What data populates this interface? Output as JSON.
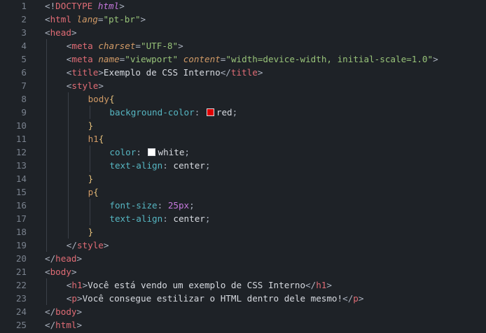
{
  "editor": {
    "lines": [
      {
        "n": "1",
        "indent": 0,
        "tokens": [
          {
            "t": "<!",
            "c": "punc"
          },
          {
            "t": "DOCTYPE",
            "c": "tag"
          },
          {
            "t": " ",
            "c": "text"
          },
          {
            "t": "html",
            "c": "kw"
          },
          {
            "t": ">",
            "c": "punc"
          }
        ]
      },
      {
        "n": "2",
        "indent": 0,
        "tokens": [
          {
            "t": "<",
            "c": "punc"
          },
          {
            "t": "html",
            "c": "tag"
          },
          {
            "t": " ",
            "c": "text"
          },
          {
            "t": "lang",
            "c": "attr"
          },
          {
            "t": "=",
            "c": "punc"
          },
          {
            "t": "\"pt-br\"",
            "c": "str"
          },
          {
            "t": ">",
            "c": "punc"
          }
        ]
      },
      {
        "n": "3",
        "indent": 0,
        "tokens": [
          {
            "t": "<",
            "c": "punc"
          },
          {
            "t": "head",
            "c": "tag"
          },
          {
            "t": ">",
            "c": "punc"
          }
        ]
      },
      {
        "n": "4",
        "indent": 1,
        "tokens": [
          {
            "t": "<",
            "c": "punc"
          },
          {
            "t": "meta",
            "c": "tag"
          },
          {
            "t": " ",
            "c": "text"
          },
          {
            "t": "charset",
            "c": "attr"
          },
          {
            "t": "=",
            "c": "punc"
          },
          {
            "t": "\"UTF-8\"",
            "c": "str"
          },
          {
            "t": ">",
            "c": "punc"
          }
        ]
      },
      {
        "n": "5",
        "indent": 1,
        "tokens": [
          {
            "t": "<",
            "c": "punc"
          },
          {
            "t": "meta",
            "c": "tag"
          },
          {
            "t": " ",
            "c": "text"
          },
          {
            "t": "name",
            "c": "attr"
          },
          {
            "t": "=",
            "c": "punc"
          },
          {
            "t": "\"viewport\"",
            "c": "str"
          },
          {
            "t": " ",
            "c": "text"
          },
          {
            "t": "content",
            "c": "attr"
          },
          {
            "t": "=",
            "c": "punc"
          },
          {
            "t": "\"width=device-width, initial-scale=1.0\"",
            "c": "str"
          },
          {
            "t": ">",
            "c": "punc"
          }
        ]
      },
      {
        "n": "6",
        "indent": 1,
        "tokens": [
          {
            "t": "<",
            "c": "punc"
          },
          {
            "t": "title",
            "c": "tag"
          },
          {
            "t": ">",
            "c": "punc"
          },
          {
            "t": "Exemplo de CSS Interno",
            "c": "text"
          },
          {
            "t": "</",
            "c": "punc"
          },
          {
            "t": "title",
            "c": "tag"
          },
          {
            "t": ">",
            "c": "punc"
          }
        ]
      },
      {
        "n": "7",
        "indent": 1,
        "tokens": [
          {
            "t": "<",
            "c": "punc"
          },
          {
            "t": "style",
            "c": "tag"
          },
          {
            "t": ">",
            "c": "punc"
          }
        ]
      },
      {
        "n": "8",
        "indent": 2,
        "tokens": [
          {
            "t": "body",
            "c": "sel"
          },
          {
            "t": "{",
            "c": "brace"
          }
        ]
      },
      {
        "n": "9",
        "indent": 3,
        "tokens": [
          {
            "t": "background-color",
            "c": "prop"
          },
          {
            "t": ": ",
            "c": "punc"
          },
          {
            "swatch": "#e00000"
          },
          {
            "t": "red",
            "c": "val"
          },
          {
            "t": ";",
            "c": "punc"
          }
        ]
      },
      {
        "n": "10",
        "indent": 2,
        "tokens": [
          {
            "t": "}",
            "c": "brace"
          }
        ]
      },
      {
        "n": "11",
        "indent": 2,
        "tokens": [
          {
            "t": "h1",
            "c": "sel"
          },
          {
            "t": "{",
            "c": "brace"
          }
        ]
      },
      {
        "n": "12",
        "indent": 3,
        "tokens": [
          {
            "t": "color",
            "c": "prop"
          },
          {
            "t": ": ",
            "c": "punc"
          },
          {
            "swatch": "#ffffff"
          },
          {
            "t": "white",
            "c": "val"
          },
          {
            "t": ";",
            "c": "punc"
          }
        ]
      },
      {
        "n": "13",
        "indent": 3,
        "tokens": [
          {
            "t": "text-align",
            "c": "prop"
          },
          {
            "t": ": ",
            "c": "punc"
          },
          {
            "t": "center",
            "c": "val"
          },
          {
            "t": ";",
            "c": "punc"
          }
        ]
      },
      {
        "n": "14",
        "indent": 2,
        "tokens": [
          {
            "t": "}",
            "c": "brace"
          }
        ]
      },
      {
        "n": "15",
        "indent": 2,
        "tokens": [
          {
            "t": "p",
            "c": "sel"
          },
          {
            "t": "{",
            "c": "brace"
          }
        ]
      },
      {
        "n": "16",
        "indent": 3,
        "tokens": [
          {
            "t": "font-size",
            "c": "prop"
          },
          {
            "t": ": ",
            "c": "punc"
          },
          {
            "t": "25px",
            "c": "num"
          },
          {
            "t": ";",
            "c": "punc"
          }
        ]
      },
      {
        "n": "17",
        "indent": 3,
        "tokens": [
          {
            "t": "text-align",
            "c": "prop"
          },
          {
            "t": ": ",
            "c": "punc"
          },
          {
            "t": "center",
            "c": "val"
          },
          {
            "t": ";",
            "c": "punc"
          }
        ]
      },
      {
        "n": "18",
        "indent": 2,
        "tokens": [
          {
            "t": "}",
            "c": "brace"
          }
        ]
      },
      {
        "n": "19",
        "indent": 1,
        "tokens": [
          {
            "t": "</",
            "c": "punc"
          },
          {
            "t": "style",
            "c": "tag"
          },
          {
            "t": ">",
            "c": "punc"
          }
        ]
      },
      {
        "n": "20",
        "indent": 0,
        "tokens": [
          {
            "t": "</",
            "c": "punc"
          },
          {
            "t": "head",
            "c": "tag"
          },
          {
            "t": ">",
            "c": "punc"
          }
        ]
      },
      {
        "n": "21",
        "indent": 0,
        "tokens": [
          {
            "t": "<",
            "c": "punc"
          },
          {
            "t": "body",
            "c": "tag"
          },
          {
            "t": ">",
            "c": "punc"
          }
        ]
      },
      {
        "n": "22",
        "indent": 1,
        "tokens": [
          {
            "t": "<",
            "c": "punc"
          },
          {
            "t": "h1",
            "c": "tag"
          },
          {
            "t": ">",
            "c": "punc"
          },
          {
            "t": "Você está vendo um exemplo de CSS Interno",
            "c": "text"
          },
          {
            "t": "</",
            "c": "punc"
          },
          {
            "t": "h1",
            "c": "tag"
          },
          {
            "t": ">",
            "c": "punc"
          }
        ]
      },
      {
        "n": "23",
        "indent": 1,
        "tokens": [
          {
            "t": "<",
            "c": "punc"
          },
          {
            "t": "p",
            "c": "tag"
          },
          {
            "t": ">",
            "c": "punc"
          },
          {
            "t": "Você consegue estilizar o HTML dentro dele mesmo!",
            "c": "text"
          },
          {
            "t": "</",
            "c": "punc"
          },
          {
            "t": "p",
            "c": "tag"
          },
          {
            "t": ">",
            "c": "punc"
          }
        ]
      },
      {
        "n": "24",
        "indent": 0,
        "tokens": [
          {
            "t": "</",
            "c": "punc"
          },
          {
            "t": "body",
            "c": "tag"
          },
          {
            "t": ">",
            "c": "punc"
          }
        ]
      },
      {
        "n": "25",
        "indent": 0,
        "tokens": [
          {
            "t": "</",
            "c": "punc"
          },
          {
            "t": "html",
            "c": "tag"
          },
          {
            "t": ">",
            "c": "punc"
          }
        ]
      }
    ]
  }
}
